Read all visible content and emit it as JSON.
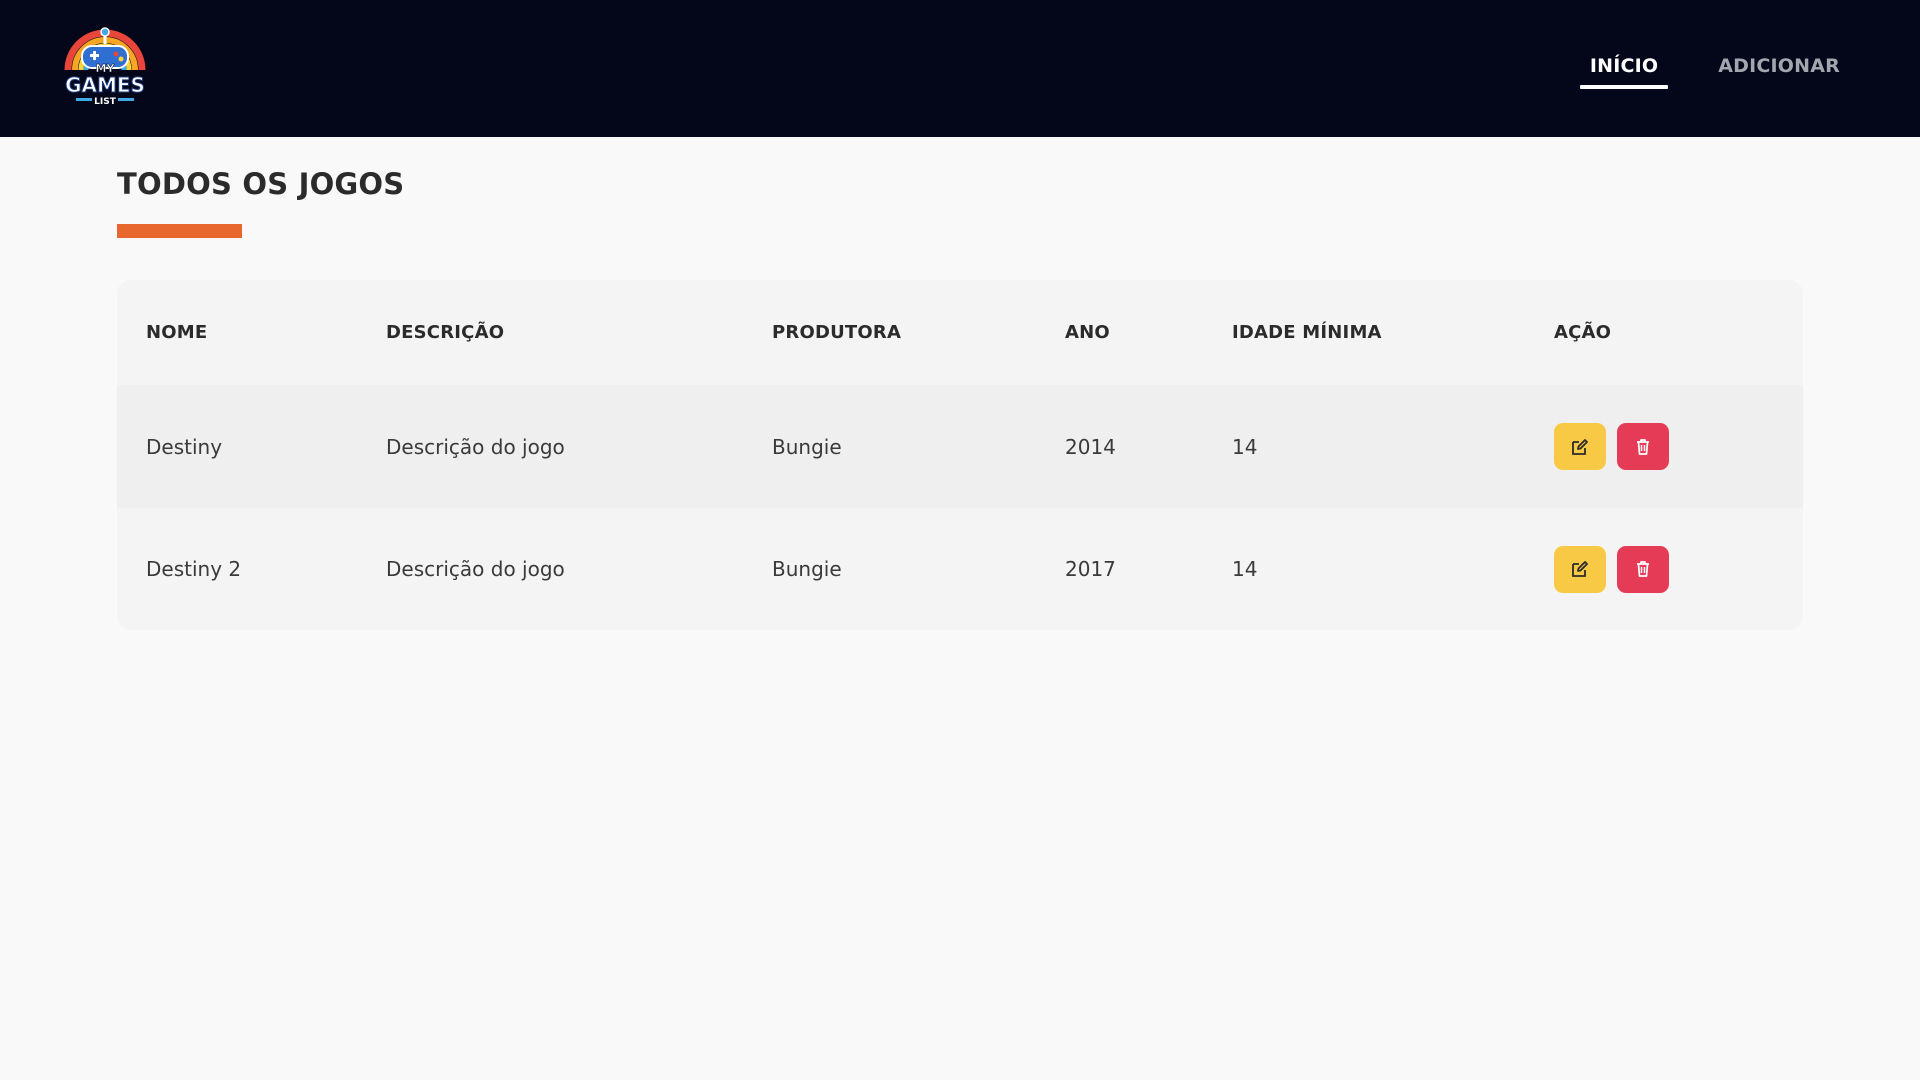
{
  "app": {
    "logo_text": [
      "MY",
      "GAMES",
      "LIST"
    ],
    "logo_icon": "gamepad-rainbow-logo"
  },
  "nav": {
    "items": [
      {
        "label": "INÍCIO",
        "active": true
      },
      {
        "label": "ADICIONAR",
        "active": false
      }
    ]
  },
  "page": {
    "title": "TODOS OS JOGOS",
    "accent_color": "#e8672e"
  },
  "table": {
    "columns": [
      "NOME",
      "DESCRIÇÃO",
      "PRODUTORA",
      "ANO",
      "IDADE MÍNIMA",
      "AÇÃO"
    ],
    "rows": [
      {
        "nome": "Destiny",
        "descricao": "Descrição do jogo",
        "produtora": "Bungie",
        "ano": "2014",
        "idade": "14"
      },
      {
        "nome": "Destiny 2",
        "descricao": "Descrição do jogo",
        "produtora": "Bungie",
        "ano": "2017",
        "idade": "14"
      }
    ],
    "action_icons": {
      "edit": "edit-icon",
      "delete": "trash-icon"
    },
    "action_colors": {
      "edit": "#f7c945",
      "delete": "#e53b57"
    }
  }
}
